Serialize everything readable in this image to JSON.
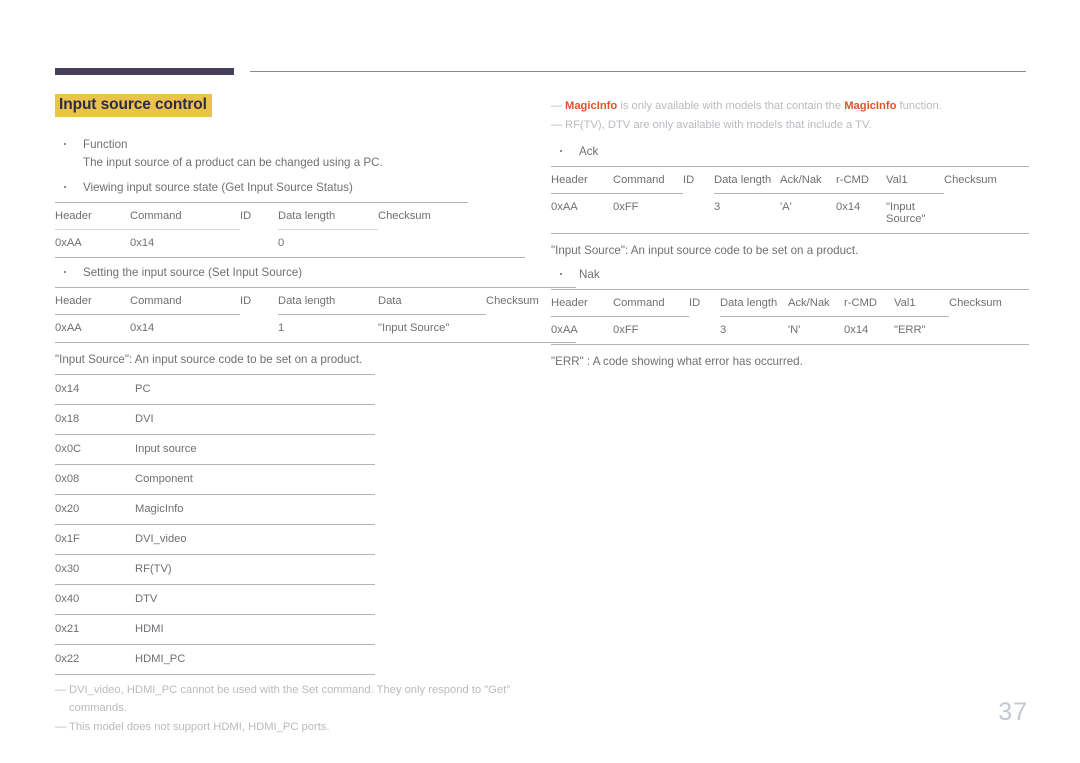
{
  "page": {
    "number": "37"
  },
  "left": {
    "title": "Input source control",
    "bullets": [
      {
        "label": "Function",
        "detail": "The input source of a product can be changed using a PC."
      },
      {
        "label": "Viewing input source state (Get Input Source Status)",
        "detail": ""
      },
      {
        "label": "Setting the input source (Set Input Source)",
        "detail": ""
      }
    ],
    "get_table": {
      "headers": [
        "Header",
        "Command",
        "ID",
        "Data length",
        "Checksum"
      ],
      "row": [
        "0xAA",
        "0x14",
        "",
        "0",
        ""
      ]
    },
    "set_table": {
      "headers": [
        "Header",
        "Command",
        "ID",
        "Data length",
        "Data",
        "Checksum"
      ],
      "row": [
        "0xAA",
        "0x14",
        "",
        "1",
        "\"Input Source\"",
        ""
      ]
    },
    "caption": "\"Input Source\": An input source code to be set on a product.",
    "codes": [
      {
        "code": "0x14",
        "name": "PC"
      },
      {
        "code": "0x18",
        "name": "DVI"
      },
      {
        "code": "0x0C",
        "name": "Input source"
      },
      {
        "code": "0x08",
        "name": "Component"
      },
      {
        "code": "0x20",
        "name": "MagicInfo"
      },
      {
        "code": "0x1F",
        "name": "DVI_video"
      },
      {
        "code": "0x30",
        "name": "RF(TV)"
      },
      {
        "code": "0x40",
        "name": "DTV"
      },
      {
        "code": "0x21",
        "name": "HDMI"
      },
      {
        "code": "0x22",
        "name": "HDMI_PC"
      }
    ],
    "notes": [
      {
        "text": "DVI_video, HDMI_PC cannot be used with the Set command. They only respond to \"Get\" commands."
      },
      {
        "text": "This model does not support HDMI, HDMI_PC ports."
      }
    ]
  },
  "right": {
    "notes": [
      {
        "pre": "",
        "hl1": "MagicInfo",
        "mid": " is only available with models that contain the ",
        "hl2": "MagicInfo",
        "post": " function."
      },
      {
        "plain": "RF(TV), DTV are only available with models that include a TV."
      }
    ],
    "ack": {
      "bullet": "Ack",
      "headers": [
        "Header",
        "Command",
        "ID",
        "Data length",
        "Ack/Nak",
        "r-CMD",
        "Val1",
        "Checksum"
      ],
      "row": [
        "0xAA",
        "0xFF",
        "",
        "3",
        "'A'",
        "0x14",
        "\"Input Source\"",
        ""
      ]
    },
    "ack_caption": "\"Input Source\": An input source code to be set on a product.",
    "nak": {
      "bullet": "Nak",
      "headers": [
        "Header",
        "Command",
        "ID",
        "Data length",
        "Ack/Nak",
        "r-CMD",
        "Val1",
        "Checksum"
      ],
      "row": [
        "0xAA",
        "0xFF",
        "",
        "3",
        "'N'",
        "0x14",
        "\"ERR\"",
        ""
      ]
    },
    "nak_caption": "\"ERR\" : A code showing what error has occurred."
  }
}
